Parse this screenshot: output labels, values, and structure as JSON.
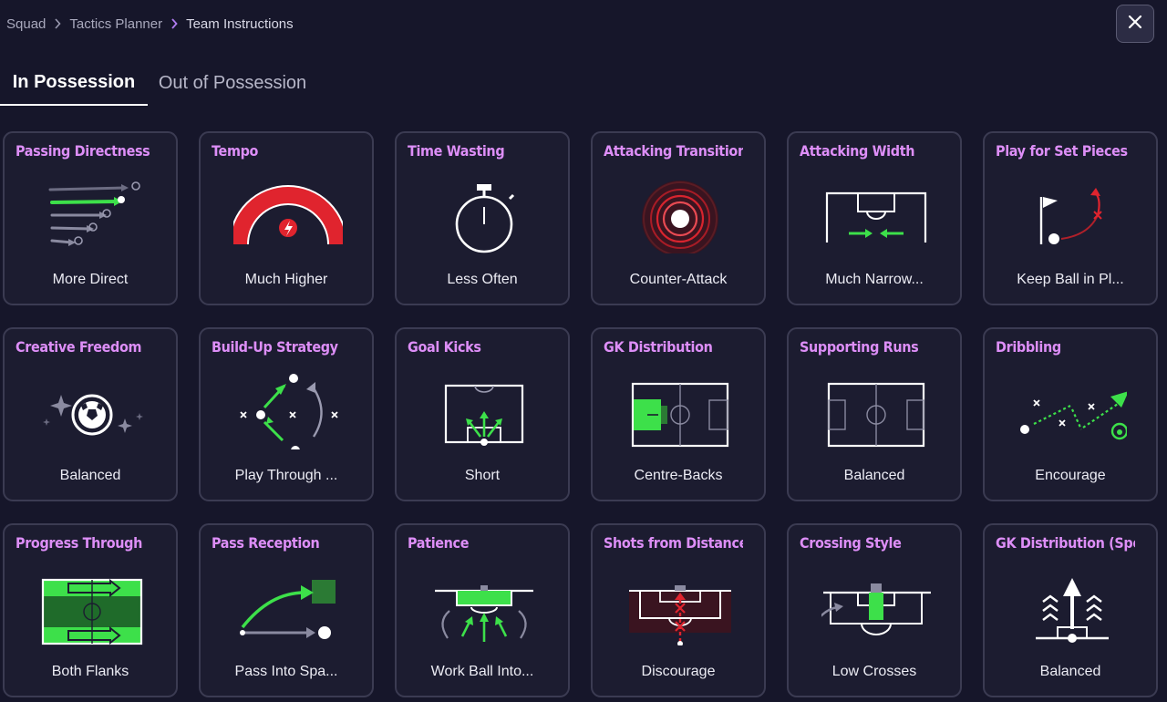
{
  "breadcrumb": {
    "items": [
      "Squad",
      "Tactics Planner",
      "Team Instructions"
    ]
  },
  "tabs": [
    {
      "label": "In Possession",
      "active": true
    },
    {
      "label": "Out of Possession",
      "active": false
    }
  ],
  "colors": {
    "accent_title": "#dd8ef7",
    "green": "#3de04a",
    "red": "#e0242e",
    "card_bg": "#1c1c30",
    "page_bg": "#16162a"
  },
  "cards": [
    {
      "title": "Passing Directness",
      "value": "More Direct",
      "icon": "passing-directness-icon"
    },
    {
      "title": "Tempo",
      "value": "Much Higher",
      "icon": "tempo-gauge-icon"
    },
    {
      "title": "Time Wasting",
      "value": "Less Often",
      "icon": "stopwatch-icon"
    },
    {
      "title": "Attacking Transition",
      "value": "Counter-Attack",
      "icon": "counter-attack-target-icon"
    },
    {
      "title": "Attacking Width",
      "value": "Much Narrow...",
      "icon": "narrow-width-icon"
    },
    {
      "title": "Play for Set Pieces",
      "value": "Keep Ball in Pl...",
      "icon": "set-piece-flag-icon"
    },
    {
      "title": "Creative Freedom",
      "value": "Balanced",
      "icon": "sparkle-ball-icon"
    },
    {
      "title": "Build-Up Strategy",
      "value": "Play Through ...",
      "icon": "build-up-icon"
    },
    {
      "title": "Goal Kicks",
      "value": "Short",
      "icon": "goal-kick-icon"
    },
    {
      "title": "GK Distribution",
      "value": "Centre-Backs",
      "icon": "gk-distribution-pitch-icon"
    },
    {
      "title": "Supporting Runs",
      "value": "Balanced",
      "icon": "supporting-runs-pitch-icon"
    },
    {
      "title": "Dribbling",
      "value": "Encourage",
      "icon": "dribbling-icon"
    },
    {
      "title": "Progress Through",
      "value": "Both Flanks",
      "icon": "both-flanks-pitch-icon"
    },
    {
      "title": "Pass Reception",
      "value": "Pass Into Spa...",
      "icon": "pass-into-space-icon"
    },
    {
      "title": "Patience",
      "value": "Work Ball Into...",
      "icon": "patience-box-icon"
    },
    {
      "title": "Shots from Distance",
      "value": "Discourage",
      "icon": "shots-distance-icon"
    },
    {
      "title": "Crossing Style",
      "value": "Low Crosses",
      "icon": "low-cross-icon"
    },
    {
      "title": "GK Distribution (Speed)",
      "value": "Balanced",
      "icon": "gk-speed-icon"
    }
  ]
}
